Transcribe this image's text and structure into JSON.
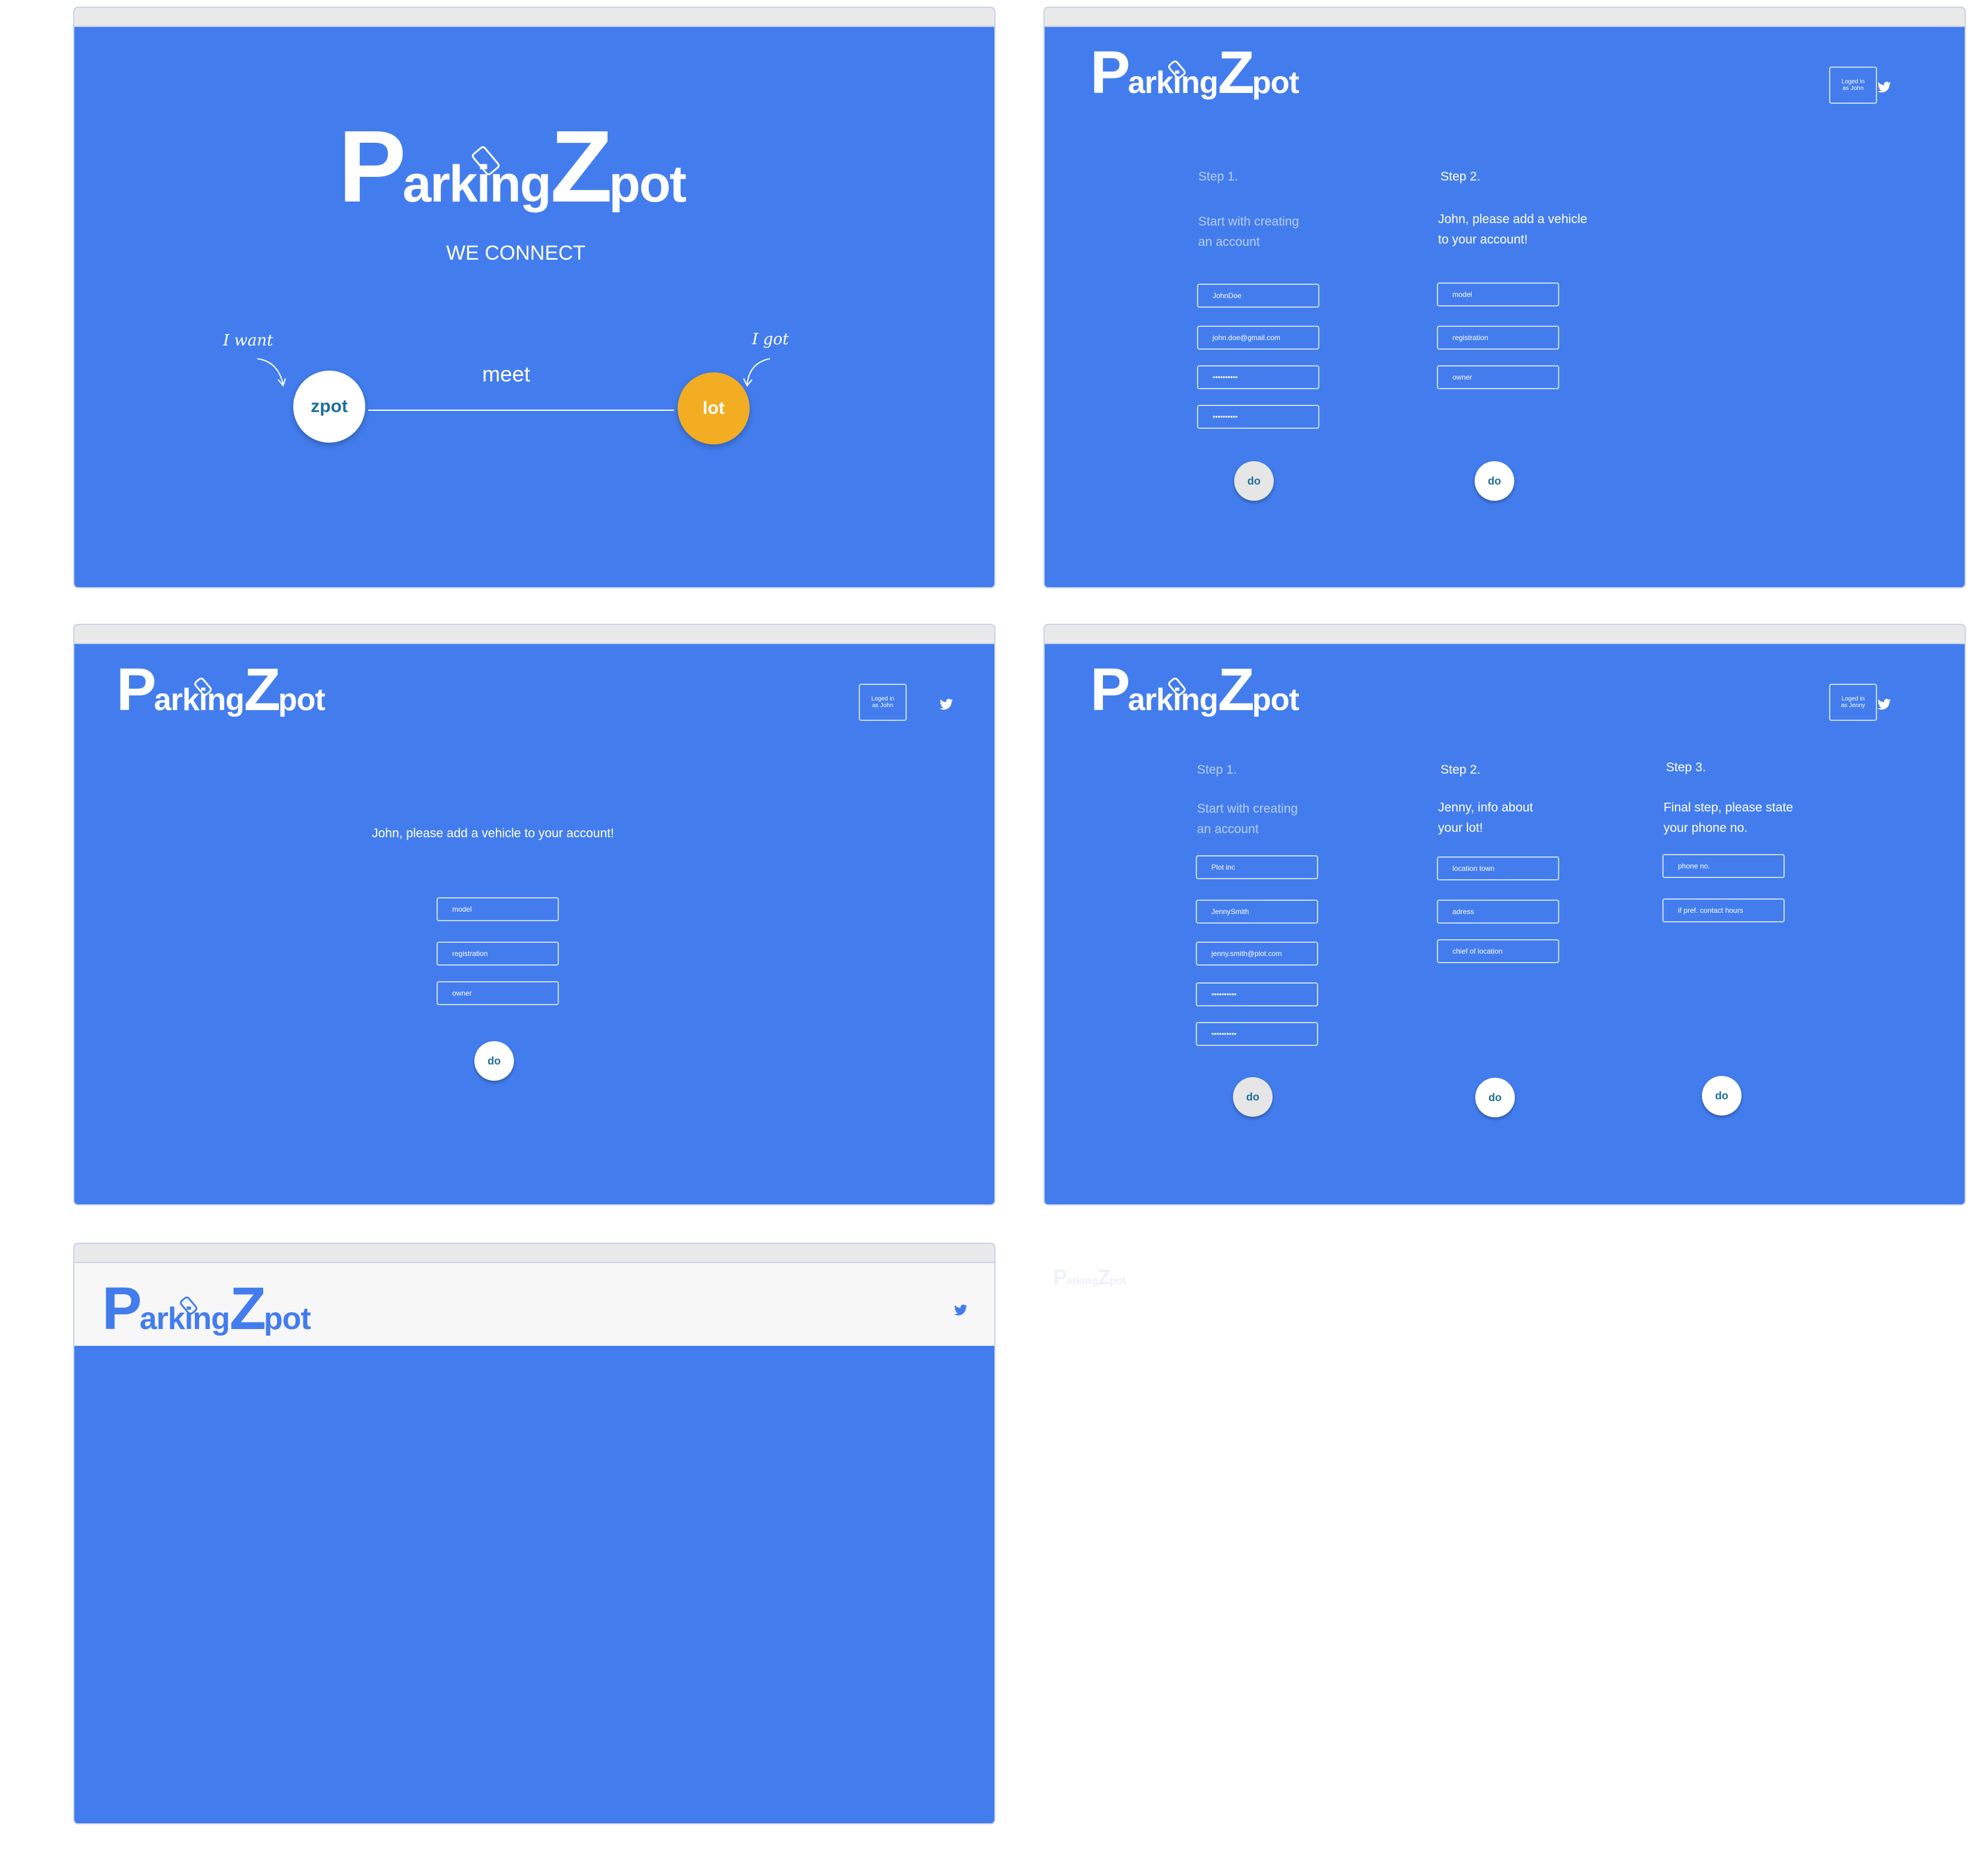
{
  "brand": {
    "logo_big_p": "P",
    "logo_mid": "arking",
    "logo_big_z": "Z",
    "logo_end": "pot",
    "primary_color": "#437ded",
    "accent_orange": "#f2ad22"
  },
  "screen1": {
    "tagline": "WE CONNECT",
    "want_label": "I want",
    "got_label": "I got",
    "meet_label": "meet",
    "zpot_circle": "zpot",
    "lot_circle": "lot"
  },
  "screen2": {
    "login_line1": "Loged in",
    "login_line2": "as John",
    "step1_heading": "Step 1.",
    "step1_text_l1": "Start with creating",
    "step1_text_l2": "an account",
    "step1_fields": [
      "JohnDoe",
      "john.doe@gmail.com",
      "••••••••••",
      "••••••••••"
    ],
    "step2_heading": "Step 2.",
    "step2_text_l1": "John, please add a vehicle",
    "step2_text_l2": "to your account!",
    "step2_fields": [
      "model",
      "registration",
      "owner"
    ],
    "do_label": "do"
  },
  "screen3": {
    "login_line1": "Loged in",
    "login_line2": "as John",
    "title": "John, please add a vehicle to your account!",
    "fields": [
      "model",
      "registration",
      "owner"
    ],
    "do_label": "do"
  },
  "screen4": {
    "login_line1": "Loged in",
    "login_line2": "as Jenny",
    "step1_heading": "Step 1.",
    "step1_text_l1": "Start with creating",
    "step1_text_l2": "an account",
    "step1_fields": [
      "Plot inc",
      "JennySmith",
      "jenny.smith@plot.com",
      "••••••••••",
      "••••••••••"
    ],
    "step2_heading": "Step 2.",
    "step2_text_l1": "Jenny, info about",
    "step2_text_l2": "your lot!",
    "step2_fields": [
      "location town",
      "adress",
      "chief of location"
    ],
    "step3_heading": "Step 3.",
    "step3_text_l1": "Final step, please state",
    "step3_text_l2": "your phone no.",
    "step3_fields": [
      "phone no.",
      "if pref. contact hours"
    ],
    "do_label": "do"
  }
}
